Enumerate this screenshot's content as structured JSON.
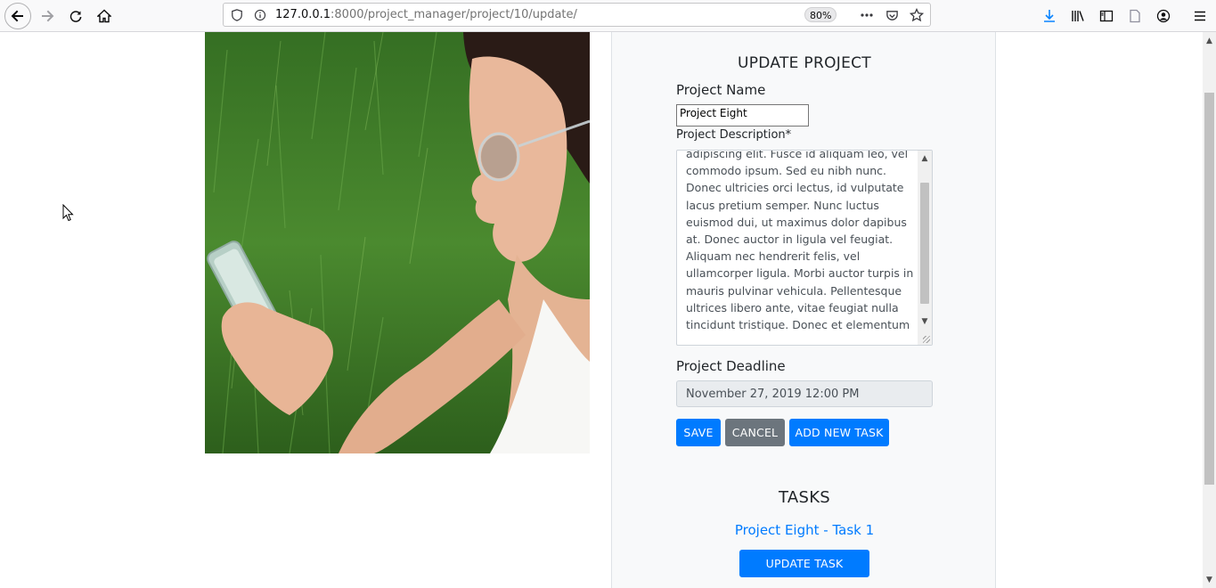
{
  "browser": {
    "url_host": "127.0.0.1",
    "url_path": ":8000/project_manager/project/10/update/",
    "zoom": "80%"
  },
  "form": {
    "title": "UPDATE PROJECT",
    "name_label": "Project Name",
    "name_value": "Project Eight",
    "description_label": "Project Description*",
    "description_text": "adipiscing elit. Fusce id aliquam leo, vel commodo ipsum. Sed eu nibh nunc. Donec ultricies orci lectus, id vulputate lacus pretium semper. Nunc luctus euismod dui, ut maximus dolor dapibus at. Donec auctor in ligula vel feugiat. Aliquam nec hendrerit felis, vel ullamcorper ligula. Morbi auctor turpis in mauris pulvinar vehicula. Pellentesque ultrices libero ante, vitae feugiat nulla tincidunt tristique. Donec et elementum",
    "deadline_label": "Project Deadline",
    "deadline_value": "November 27, 2019 12:00 PM",
    "save_label": "SAVE",
    "cancel_label": "CANCEL",
    "add_task_label": "ADD NEW TASK"
  },
  "tasks": {
    "title": "TASKS",
    "items": [
      {
        "name": "Project Eight - Task 1",
        "update_label": "UPDATE TASK"
      }
    ]
  },
  "colors": {
    "primary": "#007bff",
    "secondary": "#6c757d",
    "panel_bg": "#f8f9fa"
  }
}
